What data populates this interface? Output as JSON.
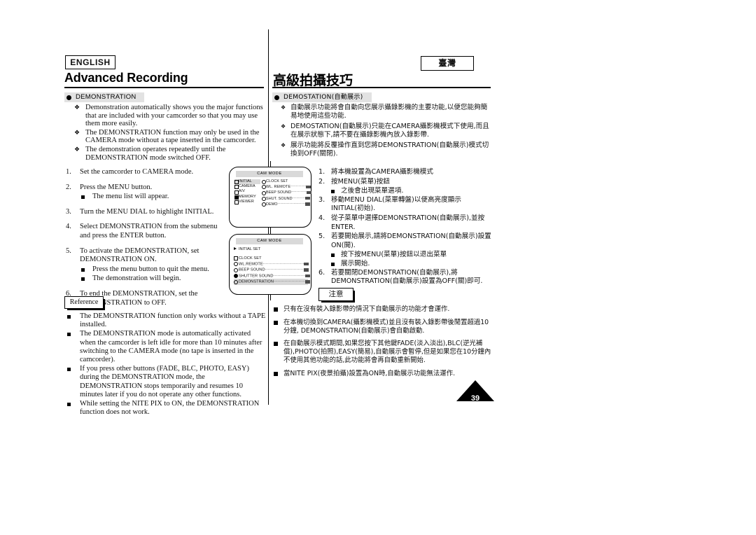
{
  "header": {
    "english_badge": "ENGLISH",
    "english_title": "Advanced Recording",
    "chinese_badge": "臺灣",
    "chinese_title": "高級拍攝技巧"
  },
  "english": {
    "section_title": "DEMONSTRATION",
    "intro": [
      "Demonstration automatically shows you the major functions that are included with your camcorder so that you may use them more easily.",
      "The DEMONSTRATION function may only be used in the CAMERA mode without a tape inserted in the camcorder.",
      "The demonstration operates repeatedly until the DEMONSTRATION mode switched OFF."
    ],
    "steps": [
      {
        "num": "1.",
        "text": "Set the camcorder to CAMERA mode.",
        "subs": []
      },
      {
        "num": "2.",
        "text": "Press the MENU button.",
        "subs": [
          "The menu list will appear."
        ]
      },
      {
        "num": "3.",
        "text": "Turn the MENU DIAL to highlight INITIAL.",
        "subs": []
      },
      {
        "num": "4.",
        "text": "Select DEMONSTRATION from the submenu and press the ENTER button.",
        "subs": []
      },
      {
        "num": "5.",
        "text": "To activate the DEMONSTRATION, set DEMONSTRATION ON.",
        "subs": [
          "Press the menu button to quit the menu.",
          "The demonstration will begin."
        ]
      },
      {
        "num": "6.",
        "text": "To end the DEMONSTRATION, set the DEMONSTRATION to OFF.",
        "subs": []
      }
    ],
    "reference_label": "Reference",
    "reference": [
      "The DEMONSTRATION function only works without a TAPE installed.",
      "The DEMONSTRATION mode is automatically activated when the camcorder is left idle for more than 10 minutes after switching to the CAMERA mode (no tape is inserted in the camcorder).",
      "If you press other buttons (FADE, BLC, PHOTO, EASY) during the DEMONSTRATION mode, the DEMONSTRATION stops temporarily and resumes 10 minutes later if you do not operate any other functions.",
      "While setting the NITE PIX to ON, the DEMONSTRATION function does not work."
    ]
  },
  "chinese": {
    "section_title": "DEMOSTATION(自動展示)",
    "intro": [
      "自動展示功能將會自動向您展示攝錄影機的主要功能,以便您能夠簡易地使用這些功能.",
      "DEMOSTATION(自動展示)只能在CAMERA攝影機模式下使用,而且在展示狀態下,請不要在攝錄影機內放入錄影帶.",
      "展示功能將反覆操作直到您將DEMONSTRATION(自動展示)模式切換到OFF(關閉)."
    ],
    "steps": [
      {
        "num": "1.",
        "text": "將本機設置為CAMERA攝影機模式",
        "subs": []
      },
      {
        "num": "2.",
        "text": "按MENU(菜單)按鈕",
        "subs": [
          "之後會出現菜單選項."
        ]
      },
      {
        "num": "3.",
        "text": "移動MENU DIAL(菜單轉盤)以便高亮度顯示INITIAL(初始).",
        "subs": []
      },
      {
        "num": "4.",
        "text": "從子菜單中選擇DEMONSTRATION(自動展示),並按ENTER.",
        "subs": []
      },
      {
        "num": "5.",
        "text": "若要開始展示,請將DEMONSTRATION(自動展示)設置ON(開).",
        "subs": [
          "按下按MENU(菜單)按鈕以退出菜單",
          "展示開始."
        ]
      },
      {
        "num": "6.",
        "text": "若要關閉DEMONSTRATION(自動展示),將DEMONSTRATION(自動展示)設置為OFF(關)即可.",
        "subs": []
      }
    ],
    "note_label": "注意",
    "notes": [
      "只有在沒有裝入錄影帶的情況下自動展示的功能才會運作.",
      "在本機切換到CAMERA(攝影機模式)並且沒有裝入錄影帶後閒置超過10分鐘, DEMONSTRATION(自動展示)會自動啟動.",
      "在自動展示模式期間,如果您按下其他鍵FADE(淡入淡出),BLC(逆光補償),PHOTO(拍照),EASY(簡易),自動展示會暫停,但是如果您在10分鐘內不使用其他功能的話,此功能將會再自動重新開始.",
      "當NITE PIX(夜景拍攝)設置為ON時,自動展示功能無法運作."
    ]
  },
  "lcd_screens": [
    {
      "caption": "CAM MODE",
      "left_column": [
        {
          "label": "INITIAL",
          "glyph": "folder",
          "selected": true
        },
        {
          "label": "CAMERA",
          "glyph": "folder",
          "selected": false
        },
        {
          "label": "A/V",
          "glyph": "folder",
          "selected": false
        },
        {
          "label": "MEMORY",
          "glyph": "folder-filled",
          "selected": false
        },
        {
          "label": "VIEWER",
          "glyph": "folder",
          "selected": false
        }
      ],
      "right_column": [
        {
          "label": "CLOCK SET",
          "glyph": "circle",
          "value": ""
        },
        {
          "label": "WL. REMOTE",
          "glyph": "circle",
          "value": "chip"
        },
        {
          "label": "BEEP SOUND",
          "glyph": "circle",
          "value": "chip"
        },
        {
          "label": "SHUT. SOUND",
          "glyph": "circle",
          "value": "chip"
        },
        {
          "label": "DEMO",
          "glyph": "circle",
          "value": "chip"
        }
      ]
    },
    {
      "caption": "CAM MODE",
      "title": "INITIAL SET",
      "items": [
        {
          "label": "CLOCK SET",
          "glyph": "folder",
          "value": "",
          "selected": false
        },
        {
          "label": "WL.REMOTE",
          "glyph": "circle",
          "value": "chip",
          "selected": false
        },
        {
          "label": "BEEP SOUND",
          "glyph": "circle",
          "value": "chip",
          "selected": false
        },
        {
          "label": "SHUTTER SOUND",
          "glyph": "circle-filled",
          "value": "chip",
          "selected": false
        },
        {
          "label": "DEMONSTRATION",
          "glyph": "circle",
          "value": "chip",
          "selected": true
        }
      ]
    }
  ],
  "page_number": "39"
}
